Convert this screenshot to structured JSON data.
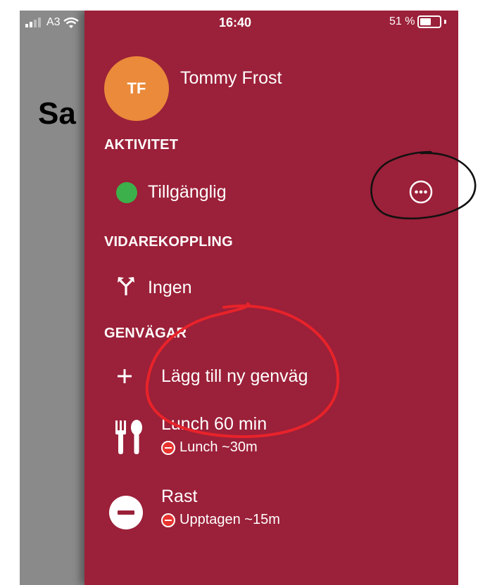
{
  "status_bar": {
    "carrier": "A3",
    "time": "16:40",
    "battery": "51 %"
  },
  "background": {
    "title_fragment": "Sa"
  },
  "profile": {
    "initials": "TF",
    "name": "Tommy Frost"
  },
  "activity": {
    "header": "AKTIVITET",
    "status": "Tillgänglig"
  },
  "forwarding": {
    "header": "VIDAREKOPPLING",
    "value": "Ingen"
  },
  "shortcuts": {
    "header": "GENVÄGAR",
    "add_label": "Lägg till ny genväg",
    "items": [
      {
        "title": "Lunch 60 min",
        "status": "Lunch ~30m",
        "icon": "fork-knife-icon"
      },
      {
        "title": "Rast",
        "status": "Upptagen ~15m",
        "icon": "do-not-disturb-icon"
      }
    ]
  },
  "colors": {
    "drawer": "#9b2039",
    "avatar": "#ea8a3a",
    "available": "#3cb04a",
    "busy": "#e8332e",
    "annotation": "#e8232a"
  }
}
